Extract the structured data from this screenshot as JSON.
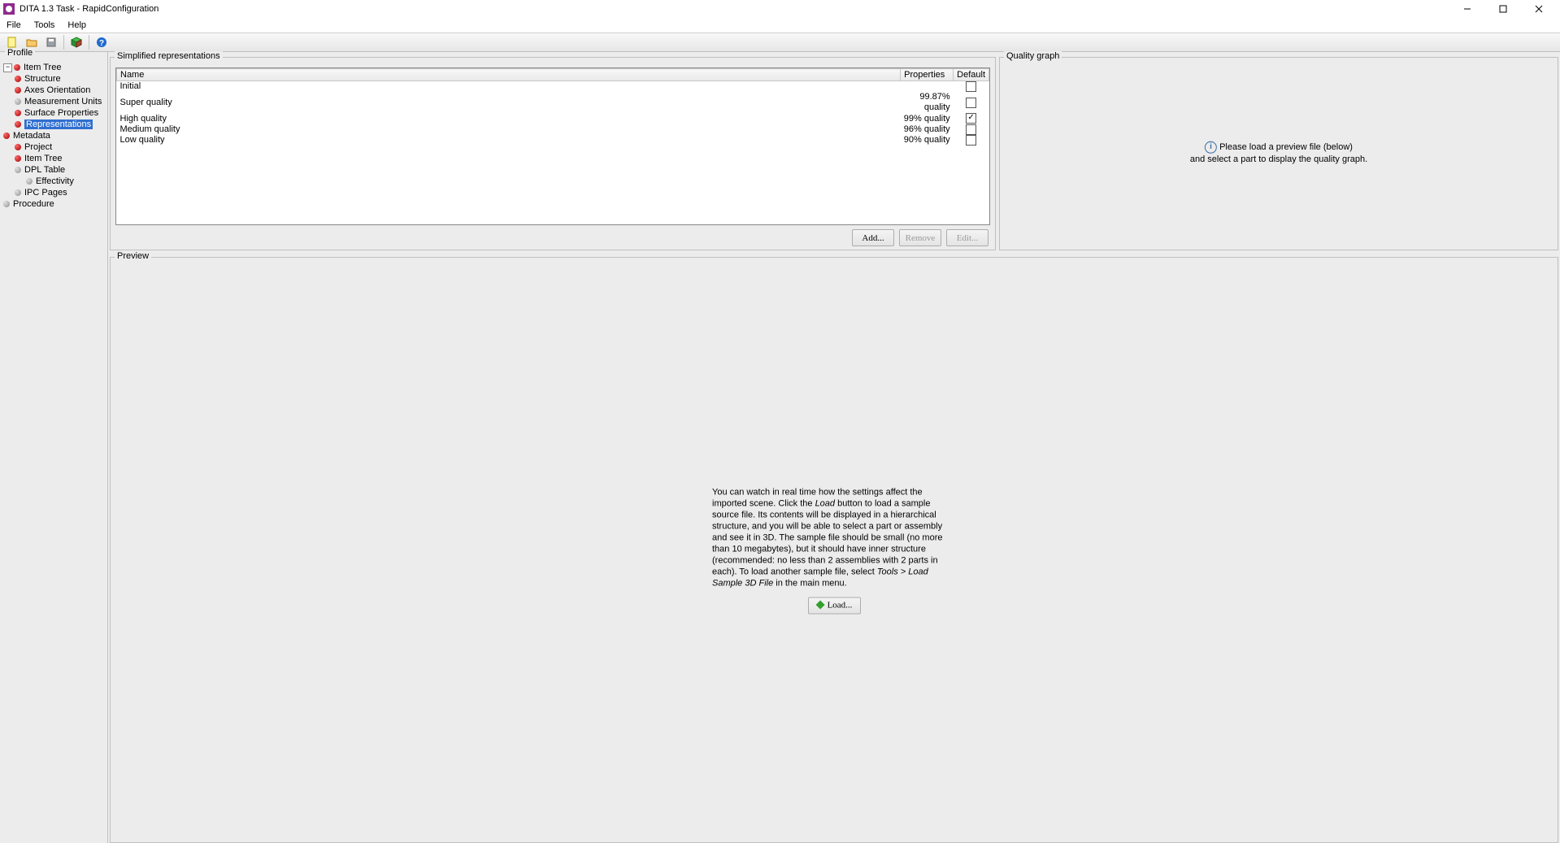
{
  "window": {
    "title": "DITA 1.3 Task - RapidConfiguration"
  },
  "menu": {
    "file": "File",
    "tools": "Tools",
    "help": "Help"
  },
  "sidebar": {
    "title": "Profile",
    "item_tree": "Item Tree",
    "structure": "Structure",
    "axes": "Axes Orientation",
    "units": "Measurement Units",
    "surface": "Surface Properties",
    "reps": "Representations",
    "metadata": "Metadata",
    "project": "Project",
    "item_tree2": "Item Tree",
    "dpl": "DPL Table",
    "eff": "Effectivity",
    "ipc": "IPC Pages",
    "procedure": "Procedure"
  },
  "reps_panel": {
    "title": "Simplified representations",
    "col_name": "Name",
    "col_props": "Properties",
    "col_default": "Default",
    "rows": [
      {
        "name": "Initial",
        "props": "",
        "def": false
      },
      {
        "name": "Super quality",
        "props": "99.87% quality",
        "def": false
      },
      {
        "name": "High quality",
        "props": "99% quality",
        "def": true
      },
      {
        "name": "Medium quality",
        "props": "96% quality",
        "def": false
      },
      {
        "name": "Low quality",
        "props": "90% quality",
        "def": false
      }
    ],
    "add": "Add...",
    "remove": "Remove",
    "edit": "Edit..."
  },
  "quality_panel": {
    "title": "Quality graph",
    "line1": "Please load a preview file (below)",
    "line2": "and select a part to display the quality graph."
  },
  "preview_panel": {
    "title": "Preview",
    "text1": "You can watch in real time how the settings affect the imported scene. Click the ",
    "italic1": "Load",
    "text2": " button to load a sample source file. Its contents will be displayed in a hierarchical structure, and you will be able to select a part or assembly and see it in 3D. The sample file should be small (no more than 10 megabytes), but it should have inner structure (recommended: no less than 2 assemblies with 2 parts in each). To load another sample file, select ",
    "italic2": "Tools > Load Sample 3D File",
    "text3": " in the main menu.",
    "load": "Load..."
  }
}
